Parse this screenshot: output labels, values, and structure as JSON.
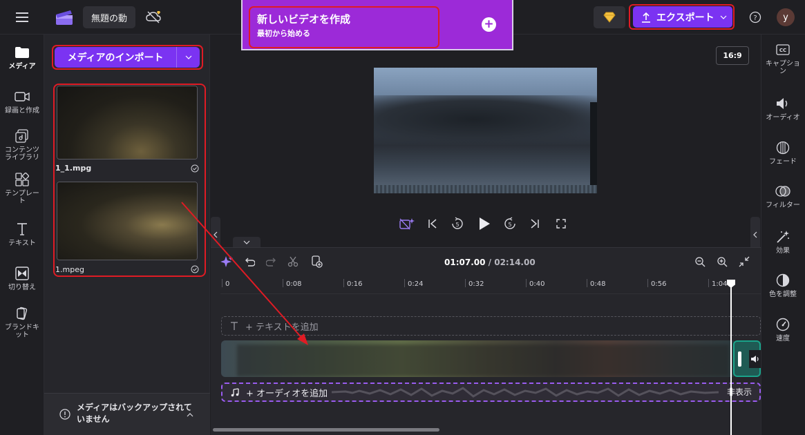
{
  "topbar": {
    "menu_icon": "hamburger-icon",
    "logo_icon": "clapperboard-logo",
    "project_title": "無題の動",
    "cloud_status_icon": "cloud-off-icon",
    "premium_icon": "diamond-icon",
    "export_label": "エクスポート",
    "help_icon": "help-icon",
    "avatar_initial": "y"
  },
  "promo": {
    "title": "新しいビデオを作成",
    "subtitle": "最初から始める"
  },
  "leftnav": {
    "items": [
      {
        "label": "メディア",
        "icon": "folder-icon",
        "active": true
      },
      {
        "label": "録画と作成",
        "icon": "camera-icon"
      },
      {
        "label": "コンテンツ\nライブラリ",
        "icon": "library-icon"
      },
      {
        "label": "テンプレート",
        "icon": "templates-icon"
      },
      {
        "label": "テキスト",
        "icon": "text-icon"
      },
      {
        "label": "切り替え",
        "icon": "transition-icon"
      },
      {
        "label": "ブランドキット",
        "icon": "brand-kit-icon"
      }
    ]
  },
  "media": {
    "import_label": "メディアのインポート",
    "files": [
      {
        "name": "1_1.mpg"
      },
      {
        "name": "1.mpeg"
      }
    ],
    "backup_notice": "メディアはバックアップされていません"
  },
  "preview": {
    "aspect_ratio": "16:9"
  },
  "timeline": {
    "current_time": "01:07.00",
    "total_time": "/ 02:14.00",
    "ticks": [
      "0",
      "0:08",
      "0:16",
      "0:24",
      "0:32",
      "0:40",
      "0:48",
      "0:56",
      "1:04"
    ],
    "add_text": "+ テキストを追加",
    "add_audio": "+ オーディオを追加",
    "audio_hide": "非表示"
  },
  "rightnav": {
    "items": [
      {
        "label": "キャプション",
        "icon": "captions-icon"
      },
      {
        "label": "オーディオ",
        "icon": "audio-icon"
      },
      {
        "label": "フェード",
        "icon": "fade-icon"
      },
      {
        "label": "フィルター",
        "icon": "filter-icon"
      },
      {
        "label": "効果",
        "icon": "effects-icon"
      },
      {
        "label": "色を調整",
        "icon": "color-adjust-icon"
      },
      {
        "label": "速度",
        "icon": "speed-icon"
      }
    ]
  },
  "colors": {
    "accent": "#7b33f2",
    "promo": "#9c2ad8",
    "highlight": "#e01b24",
    "background": "#1f1f23"
  }
}
